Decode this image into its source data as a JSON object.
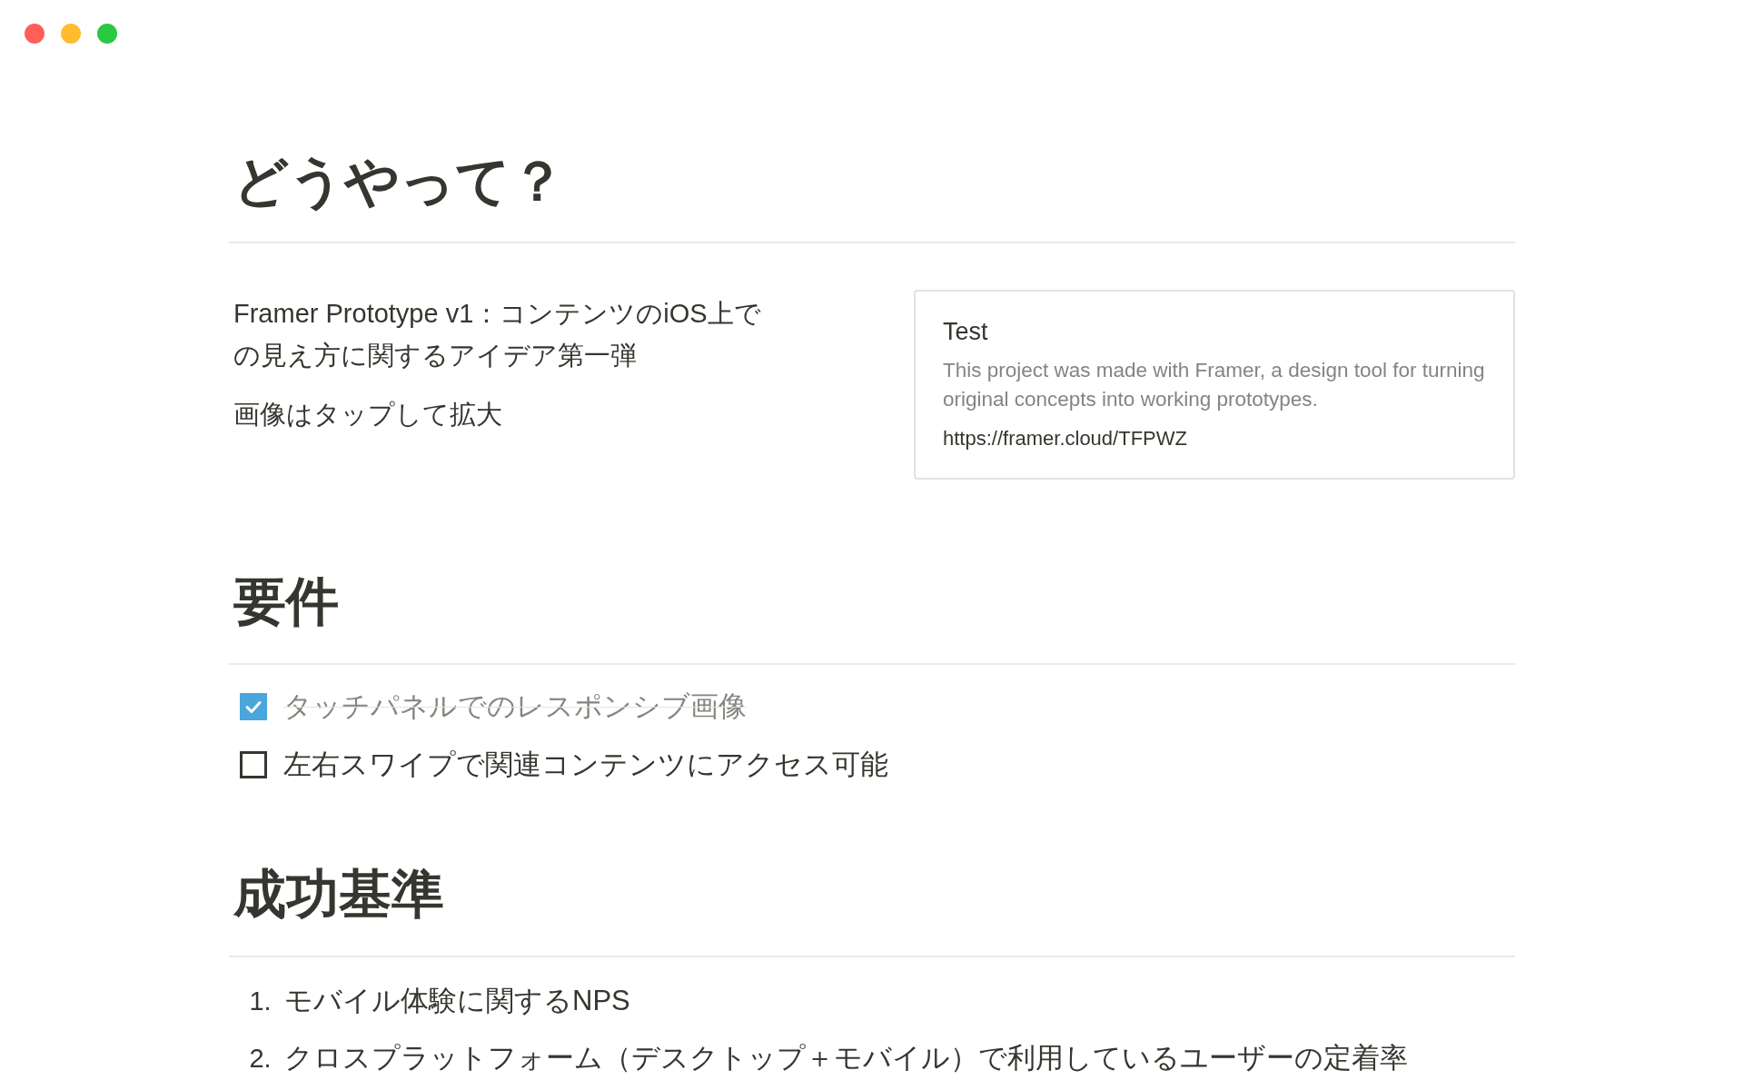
{
  "window": {
    "controls": [
      {
        "color": "#ff5f57"
      },
      {
        "color": "#febc2e"
      },
      {
        "color": "#28c840"
      }
    ]
  },
  "title": "どうやって？",
  "intro": {
    "paragraphs": [
      "Framer Prototype v1：コンテンツのiOS上での見え方に関するアイデア第一弾",
      "画像はタップして拡大"
    ],
    "bookmark": {
      "title": "Test",
      "description": "This project was made with Framer, a design tool for turning original concepts into working prototypes.",
      "url": "https://framer.cloud/TFPWZ"
    }
  },
  "sections": [
    {
      "heading": "要件",
      "kind": "todo",
      "items": [
        {
          "text": "タッチパネルでのレスポンシブ画像",
          "checked": true
        },
        {
          "text": "左右スワイプで関連コンテンツにアクセス可能",
          "checked": false
        }
      ]
    },
    {
      "heading": "成功基準",
      "kind": "numbered",
      "items": [
        {
          "number": "1.",
          "text": "モバイル体験に関するNPS"
        },
        {
          "number": "2.",
          "text": "クロスプラットフォーム（デスクトップ＋モバイル）で利用しているユーザーの定着率"
        }
      ]
    }
  ]
}
